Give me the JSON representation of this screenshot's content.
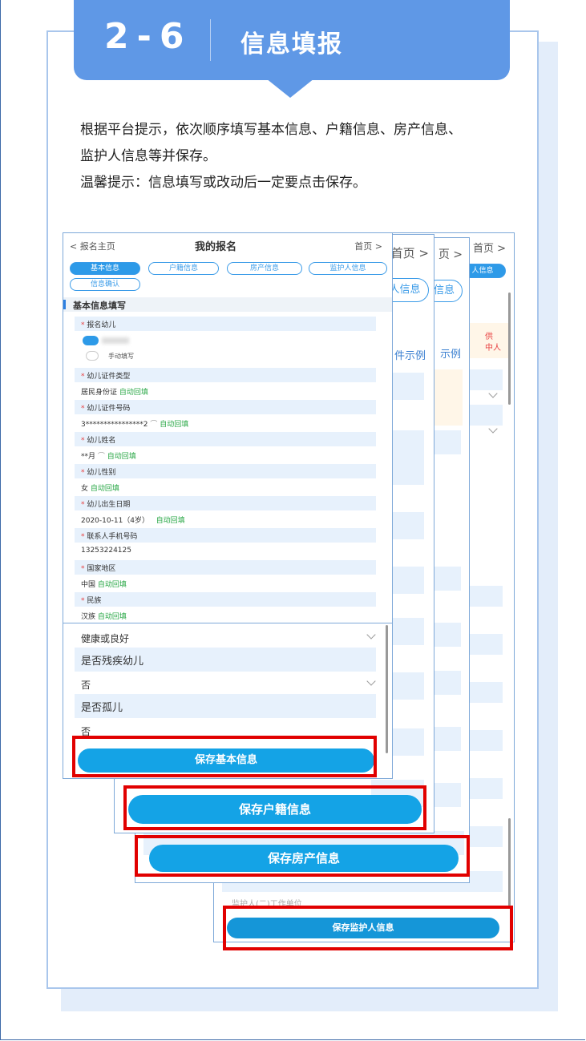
{
  "header": {
    "step_number": "2-6",
    "title": "信息填报"
  },
  "instructions": {
    "line1": "根据平台提示，依次顺序填写基本信息、户籍信息、房产信息、",
    "line2": "监护人信息等并保存。",
    "line3": "温馨提示：信息填写或改动后一定要点击保存。"
  },
  "front_panel": {
    "back_link": "< 报名主页",
    "title": "我的报名",
    "home_link": "首页 >",
    "tabs": [
      "基本信息",
      "户籍信息",
      "房产信息",
      "监护人信息",
      "信息确认"
    ],
    "section_title": "基本信息填写",
    "fields": [
      {
        "label": "报名幼儿",
        "value": ""
      },
      {
        "label": "幼儿证件类型",
        "value": "居民身份证",
        "auto": "自动回填"
      },
      {
        "label": "幼儿证件号码",
        "value": "3****************2",
        "auto": "自动回填"
      },
      {
        "label": "幼儿姓名",
        "value": "**月",
        "auto": "自动回填"
      },
      {
        "label": "幼儿性别",
        "value": "女",
        "auto": "自动回填"
      },
      {
        "label": "幼儿出生日期",
        "value": "2020-10-11（4岁）",
        "auto": "自动回填"
      },
      {
        "label": "联系人手机号码",
        "value": "13253224125"
      },
      {
        "label": "国家地区",
        "value": "中国",
        "auto": "自动回填"
      },
      {
        "label": "民族",
        "value": "汉族",
        "auto": "自动回填"
      }
    ],
    "manual_option": "手动填写",
    "required_mark": "*"
  },
  "lower_panel": {
    "health_value": "健康或良好",
    "disabled_label": "是否残疾幼儿",
    "disabled_value": "否",
    "orphan_label": "是否孤儿",
    "orphan_value": "否",
    "save_button": "保存基本信息"
  },
  "panel_2": {
    "home_link": "首页 >",
    "tab_partial": "人信息",
    "example_link": "件示例",
    "save_button": "保存户籍信息"
  },
  "panel_3": {
    "home_link": "页 >",
    "tab_partial": "信息",
    "example_link": "示例",
    "save_button": "保存房产信息"
  },
  "panel_4": {
    "home_link": "首页 >",
    "tab_partial": "人信息",
    "notice_partial_1": "供",
    "notice_partial_2": "中人",
    "work_unit_placeholder": "监护人(二)工作单位",
    "save_button": "保存监护人信息"
  },
  "colors": {
    "accent": "#14a3e6",
    "banner": "#5f98e6",
    "highlight": "#e10000",
    "auto_fill": "#28a745"
  }
}
